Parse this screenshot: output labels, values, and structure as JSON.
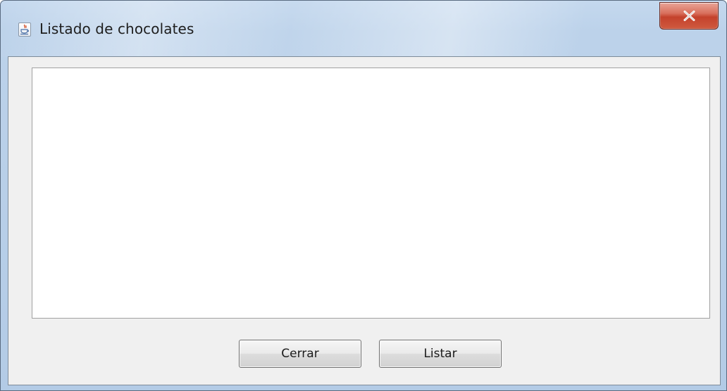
{
  "window": {
    "title": "Listado de chocolates",
    "icon": "java-cup-icon",
    "close_label": "X"
  },
  "content": {
    "list_text": ""
  },
  "buttons": {
    "cerrar_label": "Cerrar",
    "listar_label": "Listar"
  },
  "colors": {
    "frame": "#b9cfe8",
    "close_button": "#c7442c",
    "client_background": "#f0f0f0",
    "text_area": "#ffffff"
  }
}
